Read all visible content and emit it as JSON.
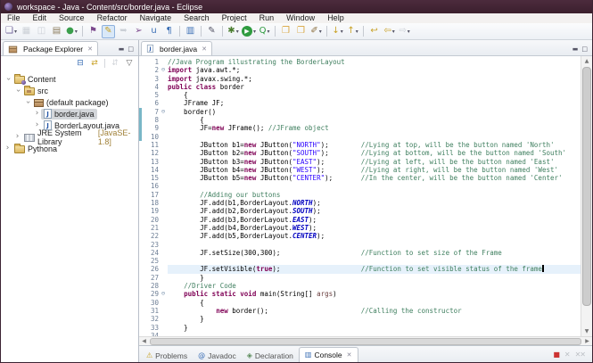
{
  "colors": {
    "kw": "#7F0055",
    "comment": "#3F7F5F",
    "str": "#2A00FF",
    "sfield": "#0000C0",
    "param": "#6A3E3E",
    "currentLine": "#e6f1fb",
    "diffBar": "#79b7c7",
    "titlebar": "#3f2230",
    "accent": "#3b6fb5"
  },
  "window": {
    "title": "workspace - Java - Content/src/border.java - Eclipse"
  },
  "chrome": {
    "minimize": "▬",
    "maximize": "□",
    "close": "✕",
    "up": "▲",
    "down": "▼",
    "left": "◀",
    "right": "▶"
  },
  "menus": [
    "File",
    "Edit",
    "Source",
    "Refactor",
    "Navigate",
    "Search",
    "Project",
    "Run",
    "Window",
    "Help"
  ],
  "toolbar": {
    "items": [
      {
        "n": "new-wizard",
        "g": "❏",
        "c": "#6b5b95",
        "dd": true
      },
      {
        "n": "save",
        "g": "▦",
        "c": "#9aa2ac",
        "dis": true
      },
      {
        "n": "save-all",
        "g": "◫",
        "c": "#9aa2ac",
        "dis": true
      },
      {
        "n": "print",
        "g": "▤",
        "c": "#8a7a5a"
      },
      {
        "n": "open-task",
        "g": "●",
        "c": "#3a9e4c",
        "dd": true
      },
      {
        "sep": true
      },
      {
        "n": "new-java-project",
        "g": "⚑",
        "c": "#7c4a8d"
      },
      {
        "n": "format-brush",
        "g": "✎",
        "c": "#c8a022",
        "active": true
      },
      {
        "n": "smart-insert",
        "g": "➥",
        "c": "#9aa2ac",
        "dis": true
      },
      {
        "n": "new-java-class",
        "g": "➢",
        "c": "#7c4a8d"
      },
      {
        "n": "junit",
        "g": "u",
        "c": "#3b6fb5"
      },
      {
        "n": "task-marker",
        "g": "¶",
        "c": "#3b6fb5"
      },
      {
        "sep": true
      },
      {
        "n": "console-view",
        "g": "▥",
        "c": "#3b6fb5"
      },
      {
        "sep": true
      },
      {
        "n": "annotate-pen",
        "g": "✎",
        "c": "#555566"
      },
      {
        "sep": true
      },
      {
        "n": "external-tools",
        "g": "✱",
        "c": "#4a7d2f",
        "dd": true
      },
      {
        "n": "run",
        "g": "▶",
        "c": "#ffffff",
        "circle": "#2e9b3f",
        "dd": true
      },
      {
        "n": "profile",
        "g": "Q",
        "c": "#2e9b3f",
        "dd": true
      },
      {
        "sep": true
      },
      {
        "n": "open-folder",
        "g": "❐",
        "c": "#d8a43c"
      },
      {
        "n": "open-resource",
        "g": "❐",
        "c": "#d8a43c"
      },
      {
        "n": "mark-occurrences",
        "g": "✐",
        "c": "#8a6d3b",
        "dd": true
      },
      {
        "sep": true
      },
      {
        "n": "next-annotation",
        "g": "↓",
        "c": "#c9a227",
        "dd": true
      },
      {
        "n": "previous-annotation",
        "g": "↑",
        "c": "#c9a227",
        "dd": true
      },
      {
        "sep": true
      },
      {
        "n": "last-edit-location",
        "g": "↩",
        "c": "#c9a227"
      },
      {
        "n": "back",
        "g": "⇦",
        "c": "#c9a227",
        "dd": true
      },
      {
        "n": "forward",
        "g": "⇨",
        "c": "#9aa2ac",
        "dis": true,
        "dd": true
      }
    ]
  },
  "package_explorer": {
    "title": "Package Explorer",
    "toolbar": [
      {
        "name": "collapse-all",
        "glyph": "⊟",
        "c": "#3b6fb5"
      },
      {
        "name": "link-with-editor",
        "glyph": "⇄",
        "c": "#c9a227"
      },
      {
        "sep": true
      },
      {
        "name": "focus-on-active-task",
        "glyph": "⇵",
        "c": "#9aa2ac",
        "disabled": true
      },
      {
        "name": "view-menu",
        "glyph": "▽",
        "c": "#666666"
      }
    ],
    "tree": [
      {
        "label": "Content",
        "depth": 0,
        "expanded": true,
        "icon": "project"
      },
      {
        "label": "src",
        "depth": 1,
        "expanded": true,
        "icon": "src"
      },
      {
        "label": "(default package)",
        "depth": 2,
        "expanded": true,
        "icon": "package"
      },
      {
        "label": "border.java",
        "depth": 3,
        "icon": "java",
        "selected": true
      },
      {
        "label": "BorderLayout.java",
        "depth": 3,
        "icon": "java"
      },
      {
        "label": "JRE System Library",
        "suffix": "[JavaSE-1.8]",
        "depth": 1,
        "icon": "lib"
      },
      {
        "label": "Pythona",
        "depth": 0,
        "icon": "folder"
      }
    ]
  },
  "editor": {
    "tab": "border.java",
    "lines": [
      {
        "segs": [
          [
            "c",
            "//Java Program illustrating the BorderLayout"
          ]
        ]
      },
      {
        "fold": true,
        "segs": [
          [
            "k",
            "import"
          ],
          [
            "p",
            " java.awt.*;"
          ]
        ]
      },
      {
        "segs": [
          [
            "k",
            "import"
          ],
          [
            "p",
            " javax.swing.*;"
          ]
        ]
      },
      {
        "segs": [
          [
            "k",
            "public class"
          ],
          [
            "p",
            " border"
          ]
        ]
      },
      {
        "segs": [
          [
            "p",
            "    {"
          ]
        ]
      },
      {
        "segs": [
          [
            "p",
            "    JFrame JF;"
          ]
        ]
      },
      {
        "fold": true,
        "diff": true,
        "segs": [
          [
            "p",
            "    border()"
          ]
        ]
      },
      {
        "diff": true,
        "segs": [
          [
            "p",
            "        {"
          ]
        ]
      },
      {
        "diff": true,
        "segs": [
          [
            "p",
            "        JF="
          ],
          [
            "k",
            "new"
          ],
          [
            "p",
            " JFrame(); "
          ],
          [
            "c",
            "//JFrame object"
          ]
        ]
      },
      {
        "diff": true,
        "segs": []
      },
      {
        "segs": [
          [
            "p",
            "        JButton b1="
          ],
          [
            "k",
            "new"
          ],
          [
            "p",
            " JButton("
          ],
          [
            "s",
            "\"NORTH\""
          ],
          [
            "p",
            ");        "
          ],
          [
            "c",
            "//Lying at top, will be the button named 'North'"
          ]
        ]
      },
      {
        "segs": [
          [
            "p",
            "        JButton b2="
          ],
          [
            "k",
            "new"
          ],
          [
            "p",
            " JButton("
          ],
          [
            "s",
            "\"SOUTH\""
          ],
          [
            "p",
            ");        "
          ],
          [
            "c",
            "//Lying at bottom, will be the button named 'South'"
          ]
        ]
      },
      {
        "segs": [
          [
            "p",
            "        JButton b3="
          ],
          [
            "k",
            "new"
          ],
          [
            "p",
            " JButton("
          ],
          [
            "s",
            "\"EAST\""
          ],
          [
            "p",
            ");         "
          ],
          [
            "c",
            "//Lying at left, will be the button named 'East'"
          ]
        ]
      },
      {
        "segs": [
          [
            "p",
            "        JButton b4="
          ],
          [
            "k",
            "new"
          ],
          [
            "p",
            " JButton("
          ],
          [
            "s",
            "\"WEST\""
          ],
          [
            "p",
            ");         "
          ],
          [
            "c",
            "//Lying at right, will be the button named 'West'"
          ]
        ]
      },
      {
        "segs": [
          [
            "p",
            "        JButton b5="
          ],
          [
            "k",
            "new"
          ],
          [
            "p",
            " JButton("
          ],
          [
            "s",
            "\"CENTER\""
          ],
          [
            "p",
            ");       "
          ],
          [
            "c",
            "//In the center, will be the button named 'Center'"
          ]
        ]
      },
      {
        "segs": []
      },
      {
        "segs": [
          [
            "p",
            "        "
          ],
          [
            "c",
            "//Adding our buttons"
          ]
        ]
      },
      {
        "segs": [
          [
            "p",
            "        JF.add(b1,BorderLayout."
          ],
          [
            "f",
            "NORTH"
          ],
          [
            "p",
            ");"
          ]
        ]
      },
      {
        "segs": [
          [
            "p",
            "        JF.add(b2,BorderLayout."
          ],
          [
            "f",
            "SOUTH"
          ],
          [
            "p",
            ");"
          ]
        ]
      },
      {
        "segs": [
          [
            "p",
            "        JF.add(b3,BorderLayout."
          ],
          [
            "f",
            "EAST"
          ],
          [
            "p",
            ");"
          ]
        ]
      },
      {
        "segs": [
          [
            "p",
            "        JF.add(b4,BorderLayout."
          ],
          [
            "f",
            "WEST"
          ],
          [
            "p",
            ");"
          ]
        ]
      },
      {
        "segs": [
          [
            "p",
            "        JF.add(b5,BorderLayout."
          ],
          [
            "f",
            "CENTER"
          ],
          [
            "p",
            ");"
          ]
        ]
      },
      {
        "segs": []
      },
      {
        "segs": [
          [
            "p",
            "        JF.setSize(300,300);                    "
          ],
          [
            "c",
            "//Function to set size of the Frame"
          ]
        ]
      },
      {
        "segs": []
      },
      {
        "current": true,
        "caret": true,
        "segs": [
          [
            "p",
            "        JF.setVisible("
          ],
          [
            "k",
            "true"
          ],
          [
            "p",
            ");                    "
          ],
          [
            "c",
            "//Function to set visible status of the frame"
          ]
        ]
      },
      {
        "segs": [
          [
            "p",
            "        }"
          ]
        ]
      },
      {
        "segs": [
          [
            "p",
            "    "
          ],
          [
            "c",
            "//Driver Code"
          ]
        ]
      },
      {
        "fold": true,
        "segs": [
          [
            "p",
            "    "
          ],
          [
            "k",
            "public static void"
          ],
          [
            "p",
            " main(String[] "
          ],
          [
            "a",
            "args"
          ],
          [
            "p",
            ")"
          ]
        ]
      },
      {
        "segs": [
          [
            "p",
            "        {"
          ]
        ]
      },
      {
        "segs": [
          [
            "p",
            "            "
          ],
          [
            "k",
            "new"
          ],
          [
            "p",
            " border();                       "
          ],
          [
            "c",
            "//Calling the constructor"
          ]
        ]
      },
      {
        "segs": [
          [
            "p",
            "        }"
          ]
        ]
      },
      {
        "segs": [
          [
            "p",
            "    }"
          ]
        ]
      },
      {
        "segs": []
      }
    ]
  },
  "bottom": {
    "tabs": [
      {
        "label": "Problems",
        "glyph": "⚠",
        "c": "#c9a227"
      },
      {
        "label": "Javadoc",
        "glyph": "@",
        "c": "#3b6fb5"
      },
      {
        "label": "Declaration",
        "glyph": "◈",
        "c": "#5a8a5a"
      },
      {
        "label": "Console",
        "glyph": "▥",
        "c": "#3b6fb5",
        "active": true,
        "closable": true
      }
    ],
    "actions": [
      {
        "name": "terminate",
        "glyph": "■",
        "c": "#cc3333"
      },
      {
        "name": "remove-launch",
        "glyph": "✕",
        "c": "#8a8f96",
        "disabled": true
      },
      {
        "name": "remove-all-terminated",
        "glyph": "✕✕",
        "c": "#8a8f96",
        "disabled": true
      }
    ]
  }
}
